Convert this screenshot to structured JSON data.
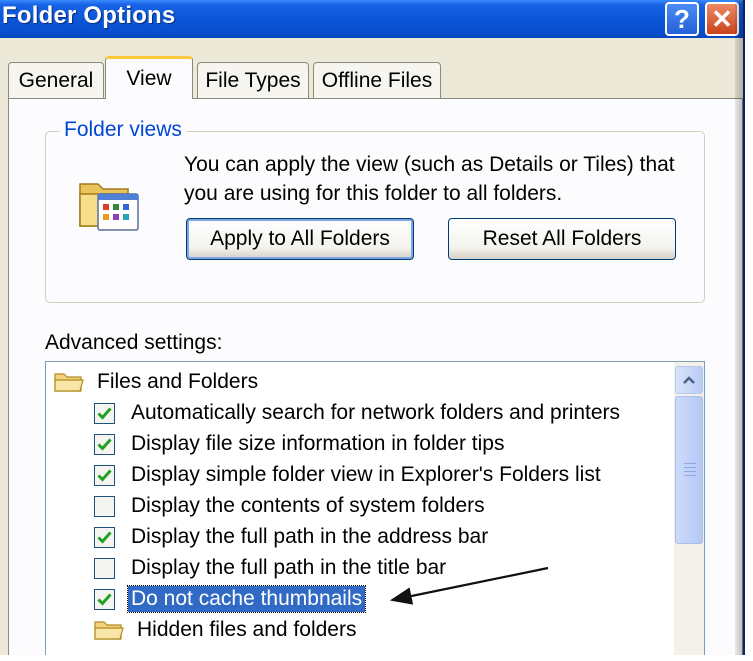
{
  "window": {
    "title": "Folder Options",
    "help_label": "?",
    "close_label": "✕"
  },
  "tabs": [
    {
      "label": "General",
      "active": false
    },
    {
      "label": "View",
      "active": true
    },
    {
      "label": "File Types",
      "active": false
    },
    {
      "label": "Offline Files",
      "active": false
    }
  ],
  "folder_views": {
    "legend": "Folder views",
    "description": "You can apply the view (such as Details or Tiles) that you are using for this folder to all folders.",
    "apply_label": "Apply to All Folders",
    "reset_label": "Reset All Folders",
    "icon": "folder-views-icon"
  },
  "advanced": {
    "label": "Advanced settings:",
    "items": [
      {
        "type": "folder",
        "label": "Files and Folders"
      },
      {
        "type": "checkbox",
        "label": "Automatically search for network folders and printers",
        "checked": true
      },
      {
        "type": "checkbox",
        "label": "Display file size information in folder tips",
        "checked": true
      },
      {
        "type": "checkbox",
        "label": "Display simple folder view in Explorer's Folders list",
        "checked": true
      },
      {
        "type": "checkbox",
        "label": "Display the contents of system folders",
        "checked": false
      },
      {
        "type": "checkbox",
        "label": "Display the full path in the address bar",
        "checked": true
      },
      {
        "type": "checkbox",
        "label": "Display the full path in the title bar",
        "checked": false
      },
      {
        "type": "checkbox",
        "label": "Do not cache thumbnails",
        "checked": true,
        "selected": true
      },
      {
        "type": "folder",
        "label": "Hidden files and folders"
      }
    ]
  },
  "colors": {
    "title_bar": "#0A57D8",
    "selection": "#316AC5",
    "checkmark": "#21A121",
    "legend": "#0046D5",
    "tab_highlight": "#FFC83C"
  }
}
